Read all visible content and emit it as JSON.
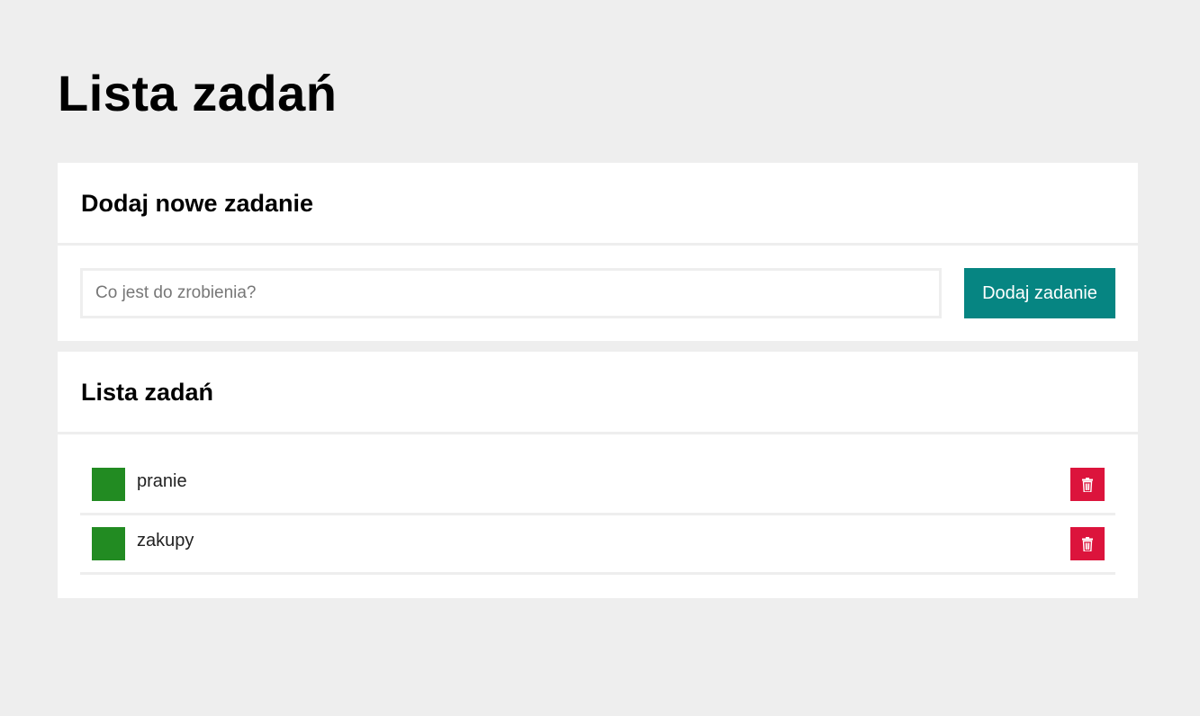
{
  "page_title": "Lista zadań",
  "add_section": {
    "heading": "Dodaj nowe zadanie",
    "input_value": "",
    "input_placeholder": "Co jest do zrobienia?",
    "add_button_label": "Dodaj zadanie"
  },
  "list_section": {
    "heading": "Lista zadań",
    "tasks": [
      {
        "label": "pranie",
        "delete_icon": "trash-icon"
      },
      {
        "label": "zakupy",
        "delete_icon": "trash-icon"
      }
    ]
  },
  "colors": {
    "background": "#eeeeee",
    "card": "#ffffff",
    "accent_button": "#068582",
    "task_check": "#228b22",
    "delete_button": "#dc143c"
  }
}
